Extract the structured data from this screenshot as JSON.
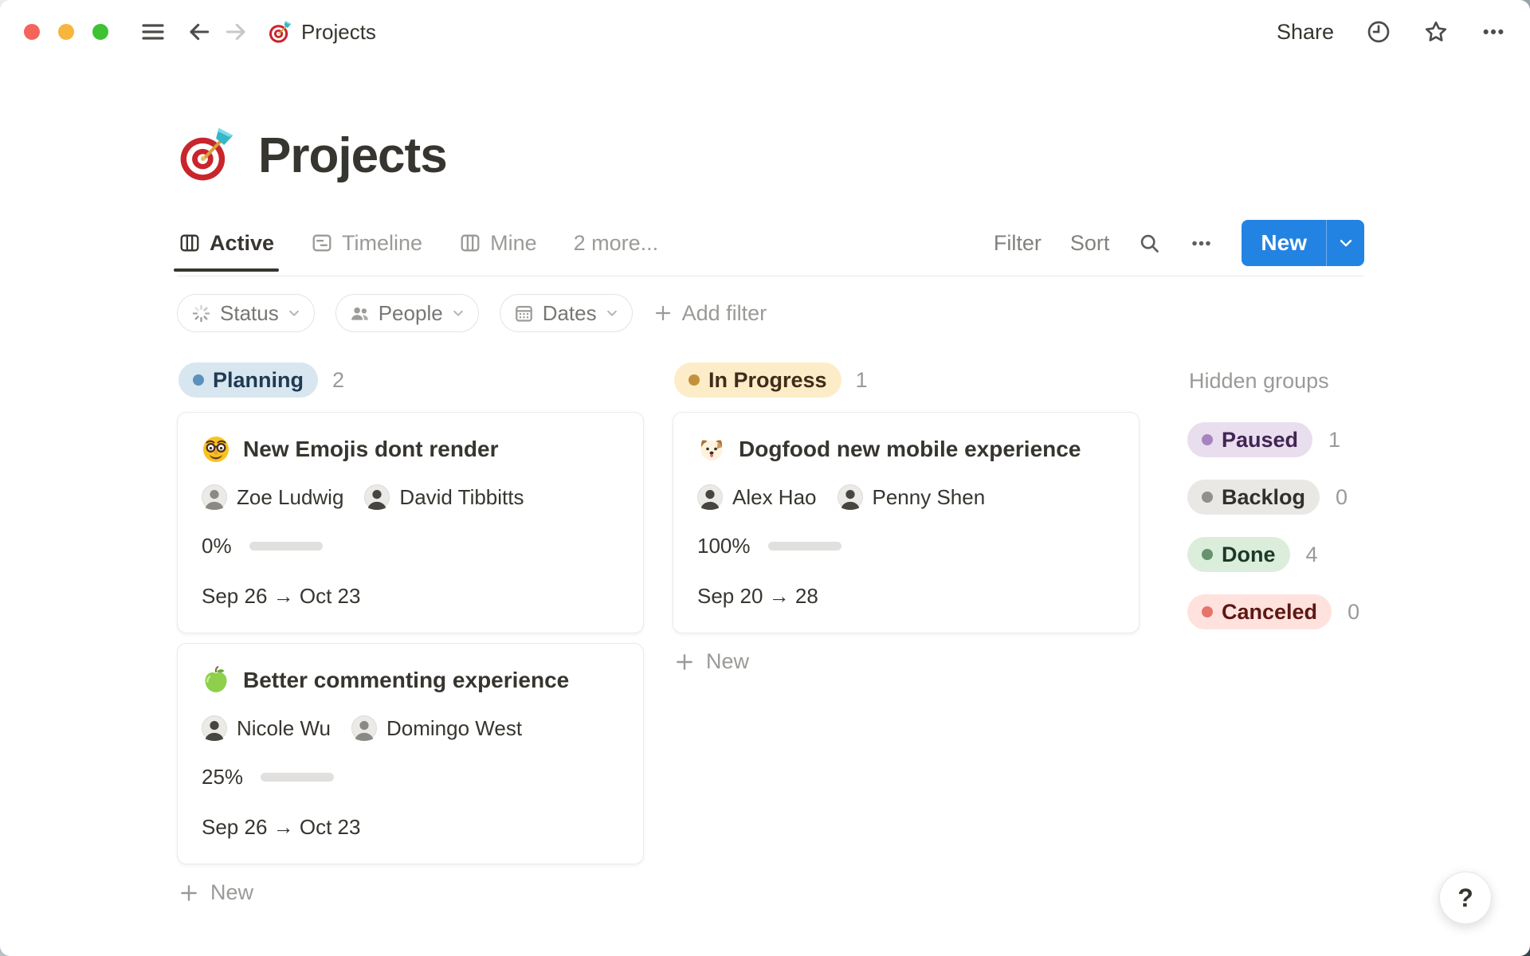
{
  "colors": {
    "accent_blue": "#2383e2",
    "text_primary": "#37352f",
    "text_muted": "#9b9a97",
    "progress_green": "#6b9b7d",
    "group_planning_bg": "#d8e6ef",
    "group_planning_dot": "#5b92bd",
    "group_in_progress_bg": "#fdecc8",
    "group_in_progress_dot": "#c5903c",
    "group_paused_bg": "#e8deee",
    "group_paused_dot": "#a584c0",
    "group_backlog_bg": "#e9e8e5",
    "group_backlog_dot": "#91908d",
    "group_done_bg": "#dbeddb",
    "group_done_dot": "#65936f",
    "group_canceled_bg": "#ffe2dd",
    "group_canceled_dot": "#e5746a"
  },
  "topbar": {
    "breadcrumb": {
      "icon": "target-emoji",
      "title": "Projects"
    },
    "share_label": "Share"
  },
  "page": {
    "icon": "target-emoji",
    "title": "Projects",
    "tabs": [
      {
        "label": "Active",
        "icon": "board-view-icon",
        "active": true
      },
      {
        "label": "Timeline",
        "icon": "timeline-view-icon",
        "active": false
      },
      {
        "label": "Mine",
        "icon": "board-view-icon",
        "active": false
      },
      {
        "label": "2 more...",
        "icon": null,
        "active": false
      }
    ],
    "toolbar": {
      "filter_label": "Filter",
      "sort_label": "Sort",
      "new_label": "New"
    },
    "filters": {
      "chips": [
        {
          "label": "Status",
          "icon": "status-spinner-icon"
        },
        {
          "label": "People",
          "icon": "people-icon"
        },
        {
          "label": "Dates",
          "icon": "calendar-icon"
        }
      ],
      "add_filter_label": "Add filter"
    },
    "board": {
      "new_card_label": "New",
      "groups": [
        {
          "name": "Planning",
          "count": "2",
          "color": "blue",
          "cards": [
            {
              "icon": "disguised-face-emoji",
              "title": "New Emojis dont  render",
              "assignees": [
                {
                  "name": "Zoe Ludwig"
                },
                {
                  "name": "David Tibbitts"
                }
              ],
              "progress_label": "0%",
              "progress_pct": 0,
              "dates": "Sep 26 → Oct 23"
            },
            {
              "icon": "green-apple-emoji",
              "title": "Better commenting experience",
              "assignees": [
                {
                  "name": "Nicole Wu"
                },
                {
                  "name": "Domingo West"
                }
              ],
              "progress_label": "25%",
              "progress_pct": 25,
              "dates": "Sep 26 → Oct 23"
            }
          ]
        },
        {
          "name": "In Progress",
          "count": "1",
          "color": "yellow",
          "cards": [
            {
              "icon": "dog-face-emoji",
              "title": "Dogfood new mobile experience",
              "assignees": [
                {
                  "name": "Alex Hao"
                },
                {
                  "name": "Penny Shen"
                }
              ],
              "progress_label": "100%",
              "progress_pct": 100,
              "dates": "Sep 20 → 28"
            }
          ]
        }
      ],
      "hidden_groups": {
        "title": "Hidden groups",
        "items": [
          {
            "name": "Paused",
            "count": "1",
            "color": "purple"
          },
          {
            "name": "Backlog",
            "count": "0",
            "color": "gray"
          },
          {
            "name": "Done",
            "count": "4",
            "color": "green"
          },
          {
            "name": "Canceled",
            "count": "0",
            "color": "red"
          }
        ]
      }
    },
    "help_label": "?"
  }
}
